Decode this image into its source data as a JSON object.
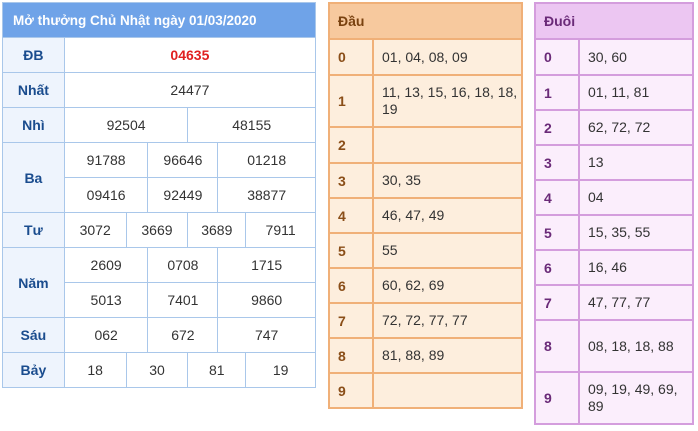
{
  "title": "Mở thưởng Chủ Nhật ngày 01/03/2020",
  "prizes": {
    "db": {
      "label": "ĐB",
      "values": [
        "04635"
      ]
    },
    "nhat": {
      "label": "Nhất",
      "values": [
        "24477"
      ]
    },
    "nhi": {
      "label": "Nhì",
      "values": [
        "92504",
        "48155"
      ]
    },
    "ba": {
      "label": "Ba",
      "values": [
        "91788",
        "96646",
        "01218",
        "09416",
        "92449",
        "38877"
      ]
    },
    "tu": {
      "label": "Tư",
      "values": [
        "3072",
        "3669",
        "3689",
        "7911"
      ]
    },
    "nam": {
      "label": "Năm",
      "values": [
        "2609",
        "0708",
        "1715",
        "5013",
        "7401",
        "9860"
      ]
    },
    "sau": {
      "label": "Sáu",
      "values": [
        "062",
        "672",
        "747"
      ]
    },
    "bay": {
      "label": "Bảy",
      "values": [
        "18",
        "30",
        "81",
        "19"
      ]
    }
  },
  "dau": {
    "header": "Đầu",
    "rows": [
      {
        "key": "0",
        "value": "01, 04, 08, 09"
      },
      {
        "key": "1",
        "value": "11, 13, 15, 16, 18, 18, 19"
      },
      {
        "key": "2",
        "value": ""
      },
      {
        "key": "3",
        "value": "30, 35"
      },
      {
        "key": "4",
        "value": "46, 47, 49"
      },
      {
        "key": "5",
        "value": "55"
      },
      {
        "key": "6",
        "value": "60, 62, 69"
      },
      {
        "key": "7",
        "value": "72, 72, 77, 77"
      },
      {
        "key": "8",
        "value": "81, 88, 89"
      },
      {
        "key": "9",
        "value": ""
      }
    ]
  },
  "duoi": {
    "header": "Đuôi",
    "rows": [
      {
        "key": "0",
        "value": "30, 60"
      },
      {
        "key": "1",
        "value": "01, 11, 81"
      },
      {
        "key": "2",
        "value": "62, 72, 72"
      },
      {
        "key": "3",
        "value": "13"
      },
      {
        "key": "4",
        "value": "04"
      },
      {
        "key": "5",
        "value": "15, 35, 55"
      },
      {
        "key": "6",
        "value": "16, 46"
      },
      {
        "key": "7",
        "value": "47, 77, 77"
      },
      {
        "key": "8",
        "value": "08, 18, 18, 88"
      },
      {
        "key": "9",
        "value": "09, 19, 49, 69, 89"
      }
    ]
  },
  "colors": {
    "header_blue": "#6fa3e8",
    "db_red": "#e02020",
    "dau_orange": "#f7c99e",
    "duoi_purple": "#ecc6f2"
  }
}
